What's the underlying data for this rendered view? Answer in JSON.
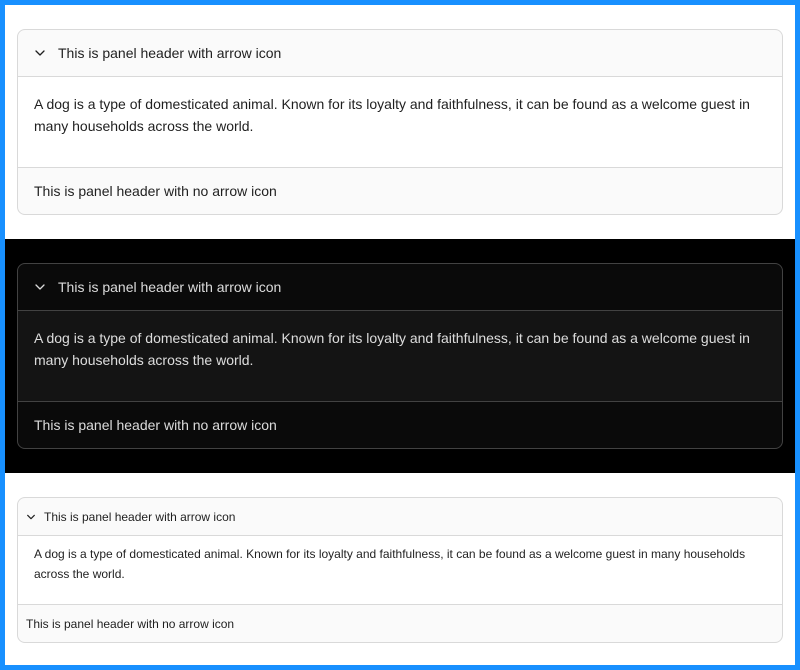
{
  "colors": {
    "frame": "#1890ff",
    "dark_background": "#000000",
    "light_panel_header": "#fafafa",
    "dark_panel_header": "#0a0a0a"
  },
  "panels": {
    "header_with_arrow": "This is panel header with arrow icon",
    "header_no_arrow": "This is panel header with no arrow icon",
    "content": "A dog is a type of domesticated animal. Known for its loyalty and faithfulness, it can be found as a welcome guest in many households across the world."
  },
  "icons": {
    "arrow": "chevron-down-icon"
  }
}
